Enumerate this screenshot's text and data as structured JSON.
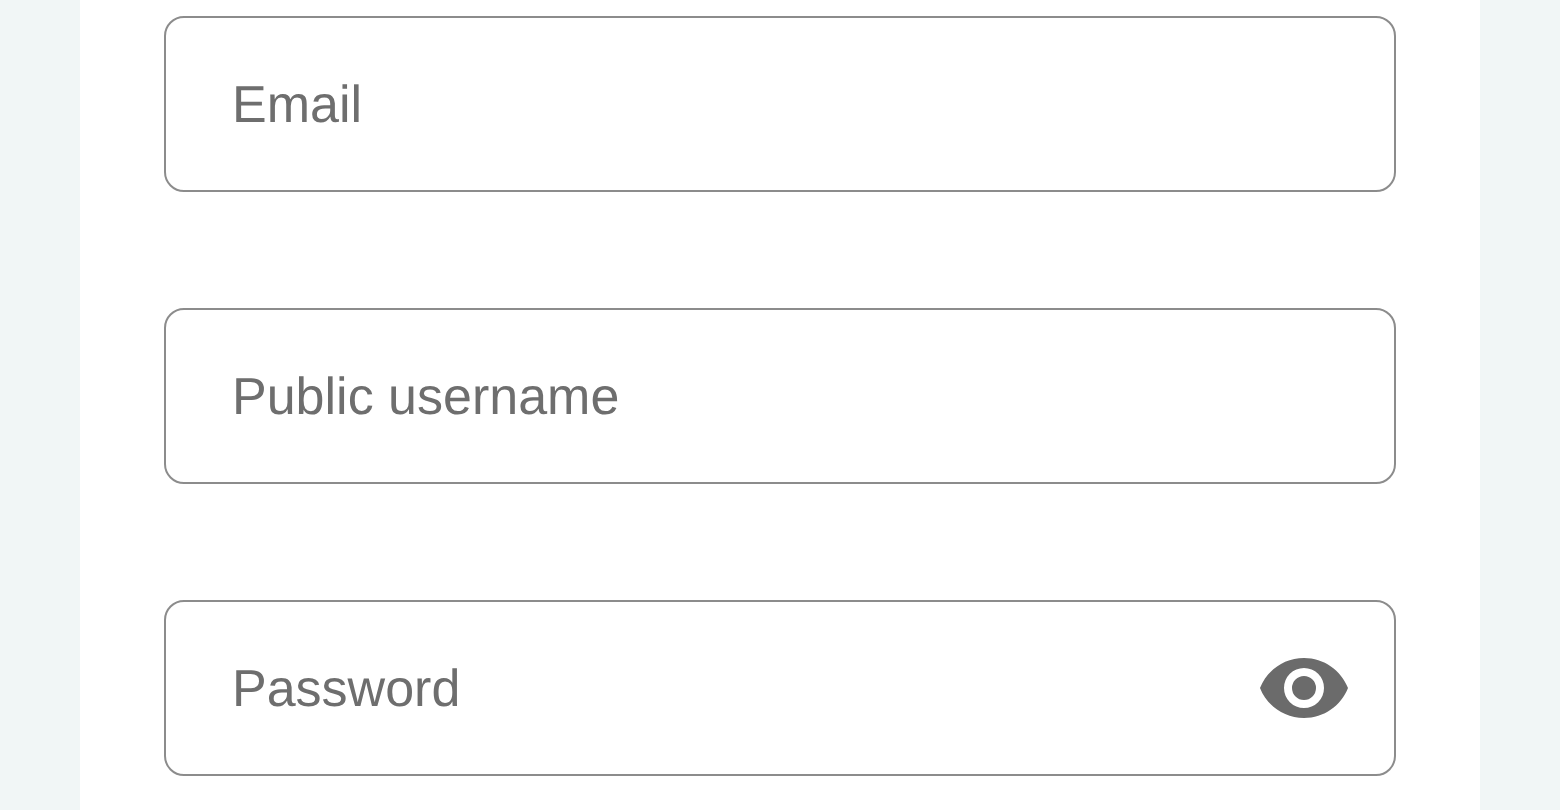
{
  "fields": [
    {
      "kind": "text",
      "placeholder": "Email"
    },
    {
      "kind": "text",
      "placeholder": "Public username"
    },
    {
      "kind": "password",
      "placeholder": "Password"
    }
  ]
}
